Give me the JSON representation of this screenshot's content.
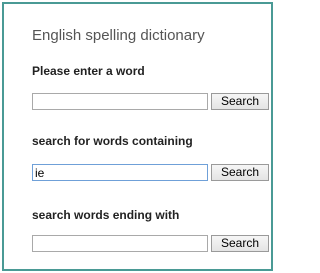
{
  "panel": {
    "title": "English spelling dictionary"
  },
  "sections": [
    {
      "label": "Please enter a word",
      "input_value": "",
      "button_label": "Search"
    },
    {
      "label": "search for words containing",
      "input_value": "ie",
      "button_label": "Search"
    },
    {
      "label": "search words ending with",
      "input_value": "",
      "button_label": "Search"
    }
  ],
  "colors": {
    "border": "#4a9a95",
    "focused_input_border": "#6fa0d8"
  }
}
